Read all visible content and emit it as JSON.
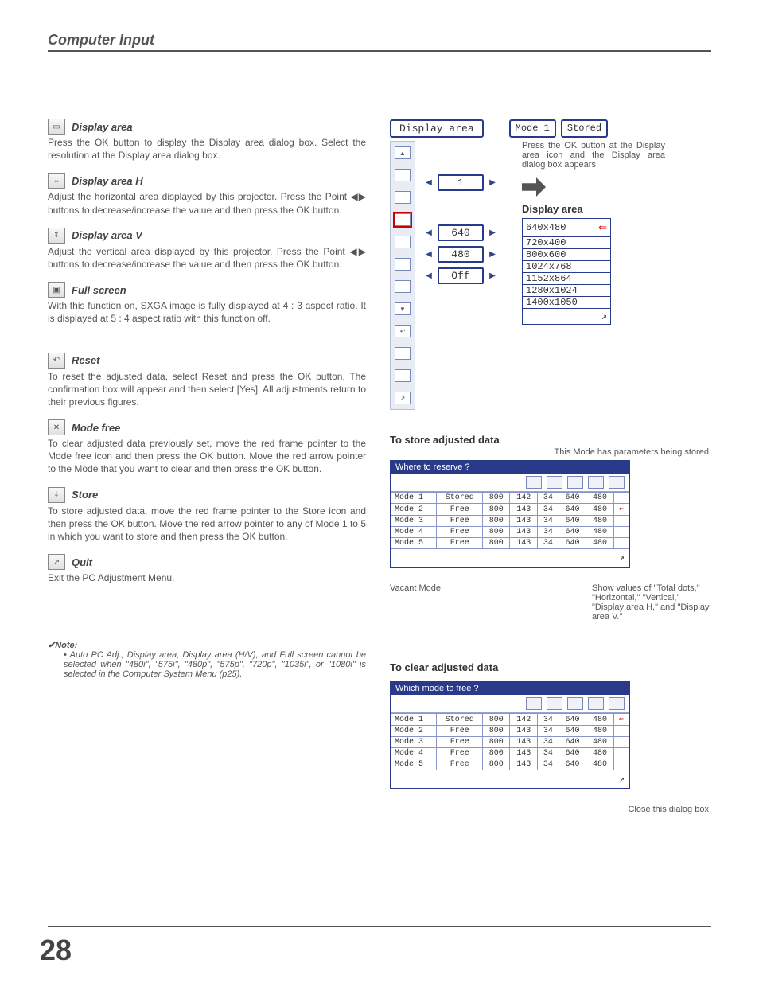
{
  "header": "Computer Input",
  "sections": {
    "display_area": {
      "title": "Display area",
      "body": "Press the OK button to display the Display area dialog box.  Select the resolution at the Display area dialog box."
    },
    "display_area_h": {
      "title": "Display area H",
      "body": "Adjust the horizontal area displayed by this projector.  Press the Point ◀▶ buttons to decrease/increase the value and then press the OK button."
    },
    "display_area_v": {
      "title": "Display area V",
      "body": "Adjust the vertical area displayed by this projector.  Press the Point ◀▶ buttons to decrease/increase the value and then press the OK button."
    },
    "full_screen": {
      "title": "Full screen",
      "body": "With this function on, SXGA image is fully displayed at 4 : 3 aspect ratio.  It is displayed at 5 : 4 aspect ratio with this function off."
    },
    "reset": {
      "title": "Reset",
      "body": "To reset the adjusted data, select Reset and press the OK button.  The confirmation box will appear and then select [Yes].  All adjustments return to their previous figures."
    },
    "mode_free": {
      "title": "Mode free",
      "body": "To clear adjusted data previously set, move the red frame pointer to the Mode free icon and then press the OK button.  Move the red arrow pointer to the Mode that you want to clear and then press the OK button."
    },
    "store": {
      "title": "Store",
      "body": "To store adjusted data, move the red frame pointer to the Store icon and then press the OK button.  Move the red arrow pointer to any of Mode 1 to 5 in which you want to store and then press the OK button."
    },
    "quit": {
      "title": "Quit",
      "body": "Exit the PC Adjustment Menu."
    }
  },
  "da_panel": {
    "heading": "Display area",
    "mode_label": "Mode 1",
    "stored_label": "Stored",
    "caption": "Press the OK button at the Display area icon and the Display area dialog box appears.",
    "right_label": "Display area",
    "values": {
      "v1": "1",
      "v2": "640",
      "v3": "480",
      "v4": "Off"
    },
    "resolutions": [
      "640x480",
      "720x400",
      "800x600",
      "1024x768",
      "1152x864",
      "1280x1024",
      "1400x1050"
    ]
  },
  "store_panel": {
    "heading": "To store adjusted data",
    "caption": "This Mode has parameters being stored.",
    "title_bar": "Where to reserve ?",
    "rows": [
      {
        "mode": "Mode 1",
        "status": "Stored",
        "c1": "800",
        "c2": "142",
        "c3": "34",
        "c4": "640",
        "c5": "480"
      },
      {
        "mode": "Mode 2",
        "status": "Free",
        "c1": "800",
        "c2": "143",
        "c3": "34",
        "c4": "640",
        "c5": "480"
      },
      {
        "mode": "Mode 3",
        "status": "Free",
        "c1": "800",
        "c2": "143",
        "c3": "34",
        "c4": "640",
        "c5": "480"
      },
      {
        "mode": "Mode 4",
        "status": "Free",
        "c1": "800",
        "c2": "143",
        "c3": "34",
        "c4": "640",
        "c5": "480"
      },
      {
        "mode": "Mode 5",
        "status": "Free",
        "c1": "800",
        "c2": "143",
        "c3": "34",
        "c4": "640",
        "c5": "480"
      }
    ],
    "annot_left": "Vacant Mode",
    "annot_right": "Show values of \"Total dots,\" \"Horizontal,\" \"Vertical,\" \"Display area H,\" and \"Display area V.\""
  },
  "clear_panel": {
    "heading": "To clear adjusted data",
    "title_bar": "Which mode to free ?",
    "rows": [
      {
        "mode": "Mode 1",
        "status": "Stored",
        "c1": "800",
        "c2": "142",
        "c3": "34",
        "c4": "640",
        "c5": "480"
      },
      {
        "mode": "Mode 2",
        "status": "Free",
        "c1": "800",
        "c2": "143",
        "c3": "34",
        "c4": "640",
        "c5": "480"
      },
      {
        "mode": "Mode 3",
        "status": "Free",
        "c1": "800",
        "c2": "143",
        "c3": "34",
        "c4": "640",
        "c5": "480"
      },
      {
        "mode": "Mode 4",
        "status": "Free",
        "c1": "800",
        "c2": "143",
        "c3": "34",
        "c4": "640",
        "c5": "480"
      },
      {
        "mode": "Mode 5",
        "status": "Free",
        "c1": "800",
        "c2": "143",
        "c3": "34",
        "c4": "640",
        "c5": "480"
      }
    ],
    "close_label": "Close this dialog box."
  },
  "note": {
    "head": "✔Note:",
    "body": "• Auto PC Adj., Display area, Display area (H/V), and Full screen cannot be selected when \"480i\", \"575i\", \"480p\", \"575p\", \"720p\", \"1035i\", or \"1080i\" is selected in the Computer System Menu (p25)."
  },
  "page_number": "28"
}
